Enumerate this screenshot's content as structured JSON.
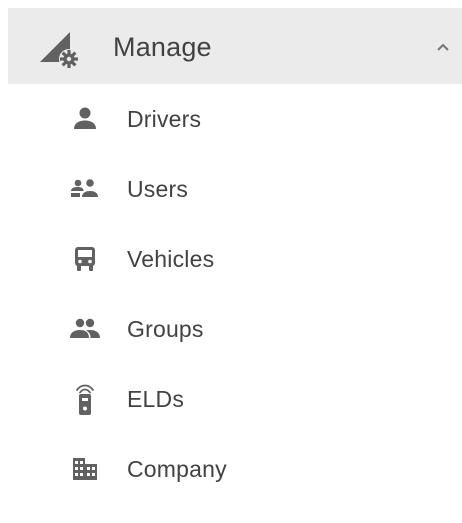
{
  "section": {
    "title": "Manage",
    "icon": "manage-gear-icon",
    "expanded": true,
    "chevron_icon": "chevron-up-icon"
  },
  "menu": {
    "items": [
      {
        "label": "Drivers",
        "icon": "person-icon"
      },
      {
        "label": "Users",
        "icon": "users-icon"
      },
      {
        "label": "Vehicles",
        "icon": "bus-icon"
      },
      {
        "label": "Groups",
        "icon": "group-icon"
      },
      {
        "label": "ELDs",
        "icon": "eld-device-icon"
      },
      {
        "label": "Company",
        "icon": "building-icon"
      }
    ]
  },
  "colors": {
    "header_bg": "#ebebeb",
    "text": "#424242",
    "icon": "#616161"
  }
}
